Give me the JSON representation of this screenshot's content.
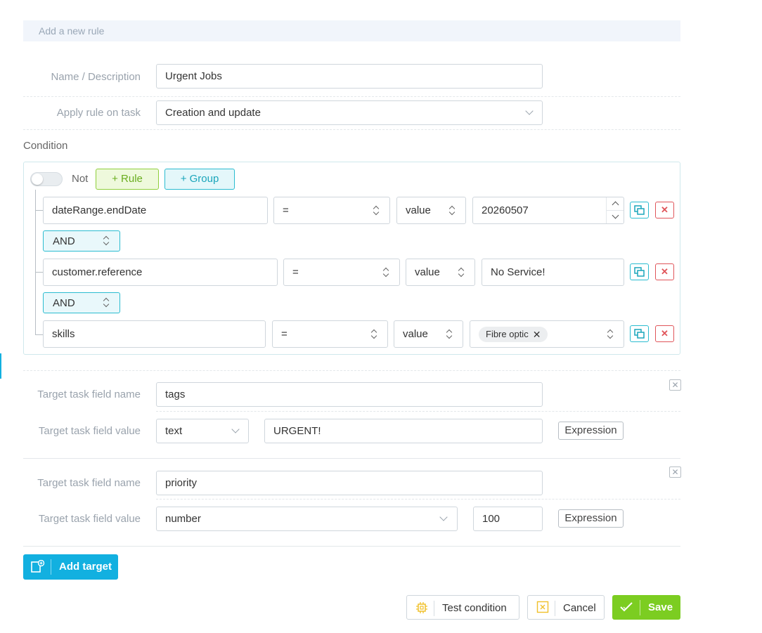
{
  "header": {
    "title": "Add a new rule"
  },
  "form": {
    "name_label": "Name / Description",
    "name_value": "Urgent Jobs",
    "apply_label": "Apply rule on task",
    "apply_value": "Creation and update"
  },
  "condition": {
    "title": "Condition",
    "not_label": "Not",
    "add_rule_label": "+ Rule",
    "add_group_label": "+ Group",
    "rules": [
      {
        "field": "dateRange.endDate",
        "operator": "=",
        "value_type": "value",
        "value": "20260507"
      },
      {
        "connector": "AND",
        "field": "customer.reference",
        "operator": "=",
        "value_type": "value",
        "value": "No Service!"
      },
      {
        "connector": "AND",
        "field": "skills",
        "operator": "=",
        "value_type": "value",
        "tag": "Fibre optic"
      }
    ]
  },
  "targets": [
    {
      "name_label": "Target task field name",
      "name_value": "tags",
      "value_label": "Target task field value",
      "type_value": "text",
      "value": "URGENT!",
      "expression_label": "Expression"
    },
    {
      "name_label": "Target task field name",
      "name_value": "priority",
      "value_label": "Target task field value",
      "type_value": "number",
      "value": "100",
      "expression_label": "Expression"
    }
  ],
  "actions": {
    "add_target_label": "Add target",
    "test_label": "Test condition",
    "cancel_label": "Cancel",
    "save_label": "Save"
  },
  "colors": {
    "accent": "#12b0e0",
    "save": "#7ccd21",
    "delete": "#e0555a",
    "group": "#2bbcd0",
    "rule": "#8fcf3c"
  },
  "icons": {
    "copy": "copy-icon",
    "delete": "close-icon",
    "add_target": "add-target-icon",
    "test": "chip-icon",
    "cancel": "cancel-icon",
    "save": "check-icon"
  }
}
